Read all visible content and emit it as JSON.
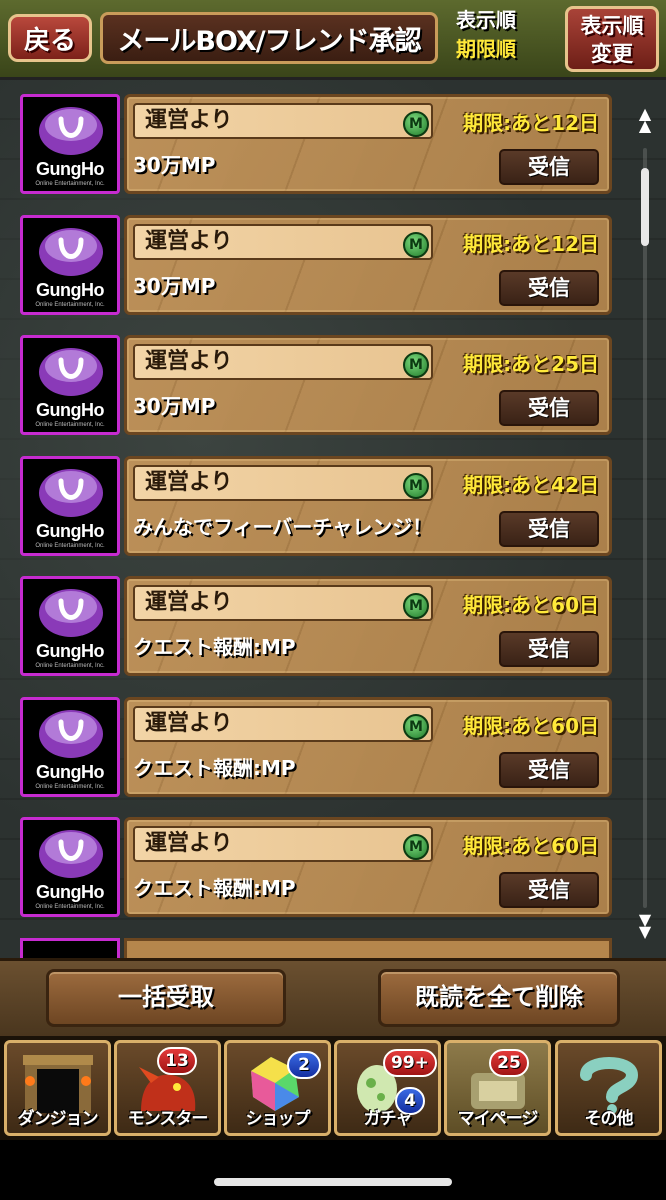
{
  "header": {
    "back_label": "戻る",
    "title": "メールBOX/フレンド承認",
    "sort_caption": "表示順",
    "sort_value": "期限順",
    "sort_change_line1": "表示順",
    "sort_change_line2": "変更"
  },
  "avatar": {
    "brand": "GungHo",
    "sub": "Online Entertainment, Inc."
  },
  "mails": [
    {
      "sender": "運営より",
      "expiry": "期限:あと12日",
      "content": "30万MP",
      "receive_label": "受信"
    },
    {
      "sender": "運営より",
      "expiry": "期限:あと12日",
      "content": "30万MP",
      "receive_label": "受信"
    },
    {
      "sender": "運営より",
      "expiry": "期限:あと25日",
      "content": "30万MP",
      "receive_label": "受信"
    },
    {
      "sender": "運営より",
      "expiry": "期限:あと42日",
      "content": "みんなでフィーバーチャレンジ！",
      "receive_label": "受信"
    },
    {
      "sender": "運営より",
      "expiry": "期限:あと60日",
      "content": "クエスト報酬:MP",
      "receive_label": "受信"
    },
    {
      "sender": "運営より",
      "expiry": "期限:あと60日",
      "content": "クエスト報酬:MP",
      "receive_label": "受信"
    },
    {
      "sender": "運営より",
      "expiry": "期限:あと60日",
      "content": "クエスト報酬:MP",
      "receive_label": "受信"
    }
  ],
  "m_icon_label": "M",
  "actions": {
    "bulk_receive": "一括受取",
    "delete_all_read": "既読を全て削除"
  },
  "nav": {
    "dungeon": {
      "label": "ダンジョン"
    },
    "monster": {
      "label": "モンスター",
      "badge": "13"
    },
    "shop": {
      "label": "ショップ",
      "badge": "2"
    },
    "gacha": {
      "label": "ガチャ",
      "badge": "99+",
      "badge2": "4"
    },
    "mypage": {
      "label": "マイページ",
      "badge": "25"
    },
    "other": {
      "label": "その他"
    }
  },
  "colors": {
    "expiry_text": "#ffe93a",
    "avatar_border": "#c62bd0",
    "badge_red": "#e33a3a",
    "badge_blue": "#3a6ae3"
  }
}
